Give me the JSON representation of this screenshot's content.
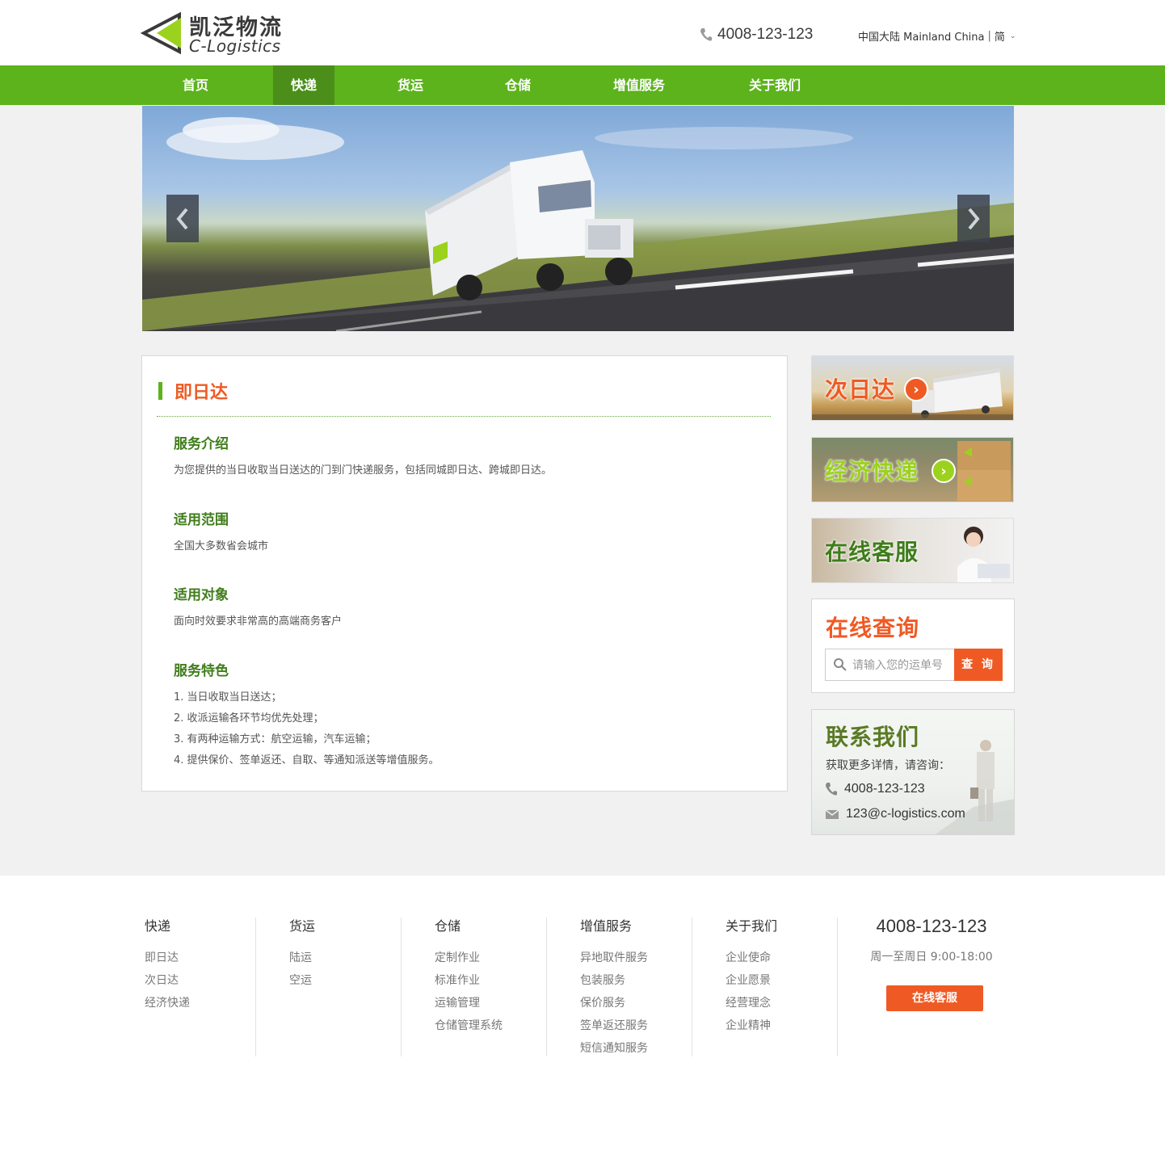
{
  "header": {
    "logo_cn": "凯泛物流",
    "logo_en": "C-Logistics",
    "hotline": "4008-123-123",
    "region_label": "中国大陆 Mainland China",
    "language": "简",
    "phone_icon": "phone-icon",
    "chevron_icon": "chevron-down-icon"
  },
  "nav": {
    "items": [
      {
        "label": "首页"
      },
      {
        "label": "快递"
      },
      {
        "label": "货运"
      },
      {
        "label": "仓储"
      },
      {
        "label": "增值服务"
      },
      {
        "label": "关于我们"
      }
    ],
    "active_index": 1
  },
  "banner": {
    "prev_icon": "chevron-left-icon",
    "next_icon": "chevron-right-icon"
  },
  "content": {
    "title": "即日达",
    "sections": [
      {
        "heading": "服务介绍",
        "text": "为您提供的当日收取当日送达的门到门快递服务，包括同城即日达、跨城即日达。"
      },
      {
        "heading": "适用范围",
        "text": "全国大多数省会城市"
      },
      {
        "heading": "适用对象",
        "text": "面向时效要求非常高的高端商务客户"
      },
      {
        "heading": "服务特色",
        "list": [
          "1. 当日收取当日送达；",
          "2. 收派运输各环节均优先处理；",
          "3. 有两种运输方式：航空运输，汽车运输；",
          "4. 提供保价、签单返还、自取、等通知派送等增值服务。"
        ]
      }
    ]
  },
  "sidebar": {
    "next_day": "次日达",
    "economy": "经济快递",
    "online_service": "在线客服",
    "query": {
      "title": "在线查询",
      "placeholder": "请输入您的运单号",
      "button": "查 询"
    },
    "contact": {
      "title": "联系我们",
      "subtitle": "获取更多详情，请咨询：",
      "phone": "4008-123-123",
      "email": "123@c-logistics.com"
    }
  },
  "footer": {
    "columns": [
      {
        "title": "快递",
        "links": [
          "即日达",
          "次日达",
          "经济快递"
        ]
      },
      {
        "title": "货运",
        "links": [
          "陆运",
          "空运"
        ]
      },
      {
        "title": "仓储",
        "links": [
          "定制作业",
          "标准作业",
          "运输管理",
          "仓储管理系统"
        ]
      },
      {
        "title": "增值服务",
        "links": [
          "异地取件服务",
          "包装服务",
          "保价服务",
          "签单返还服务",
          "短信通知服务"
        ]
      },
      {
        "title": "关于我们",
        "links": [
          "企业使命",
          "企业愿景",
          "经营理念",
          "企业精神"
        ]
      }
    ],
    "phone": "4008-123-123",
    "hours": "周一至周日  9:00-18:00",
    "service_button": "在线客服"
  },
  "colors": {
    "brand_green": "#5cb31c",
    "nav_active": "#4b8f1a",
    "accent_orange": "#ef5a24",
    "heading_green": "#3f7d1b"
  }
}
